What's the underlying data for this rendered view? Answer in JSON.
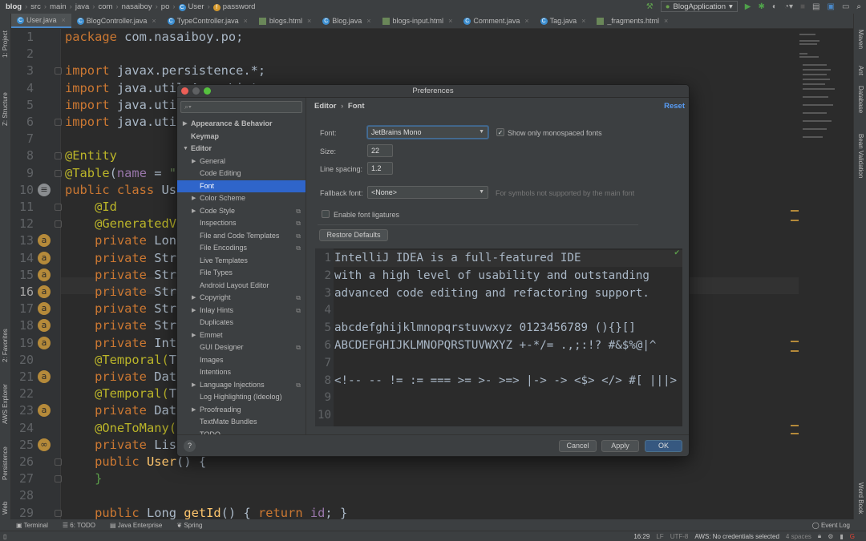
{
  "breadcrumb": [
    "blog",
    "src",
    "main",
    "java",
    "com",
    "nasaiboy",
    "po",
    "User",
    "password"
  ],
  "toolbar": {
    "run_config": "BlogApplication"
  },
  "tabs": [
    {
      "label": "User.java",
      "type": "java",
      "active": true
    },
    {
      "label": "BlogController.java",
      "type": "java"
    },
    {
      "label": "TypeController.java",
      "type": "java"
    },
    {
      "label": "blogs.html",
      "type": "html"
    },
    {
      "label": "Blog.java",
      "type": "java"
    },
    {
      "label": "blogs-input.html",
      "type": "html"
    },
    {
      "label": "Comment.java",
      "type": "java"
    },
    {
      "label": "Tag.java",
      "type": "java"
    },
    {
      "label": "_fragments.html",
      "type": "html"
    }
  ],
  "left_stripe": [
    "1: Project",
    "Z: Structure",
    "2: Favorites",
    "AWS Explorer",
    "Persistence",
    "Web"
  ],
  "right_stripe": [
    "Maven",
    "Ant",
    "Database",
    "Bean Validation",
    "Word Book"
  ],
  "editor": {
    "current_line": 16,
    "lines": [
      [
        [
          "k",
          "package "
        ],
        [
          "t",
          "com.nasaiboy.po;"
        ]
      ],
      [],
      [
        [
          "k",
          "import "
        ],
        [
          "t",
          "javax.persistence.*;"
        ]
      ],
      [
        [
          "k",
          "import "
        ],
        [
          "t",
          "java.util.ArrayList;"
        ]
      ],
      [
        [
          "k",
          "import "
        ],
        [
          "t",
          "java.util."
        ]
      ],
      [
        [
          "k",
          "import "
        ],
        [
          "t",
          "java.util."
        ]
      ],
      [],
      [
        [
          "a",
          "@Entity"
        ]
      ],
      [
        [
          "a",
          "@Table"
        ],
        [
          "t",
          "("
        ],
        [
          "f",
          "name"
        ],
        [
          "t",
          " = "
        ],
        [
          "s",
          "\"t_"
        ]
      ],
      [
        [
          "k",
          "public class "
        ],
        [
          "t",
          "User"
        ]
      ],
      [
        [
          "t",
          "    "
        ],
        [
          "a",
          "@Id"
        ]
      ],
      [
        [
          "t",
          "    "
        ],
        [
          "a",
          "@GeneratedVal"
        ]
      ],
      [
        [
          "t",
          "    "
        ],
        [
          "k",
          "private "
        ],
        [
          "t",
          "Long"
        ]
      ],
      [
        [
          "t",
          "    "
        ],
        [
          "k",
          "private "
        ],
        [
          "t",
          "Strin"
        ]
      ],
      [
        [
          "t",
          "    "
        ],
        [
          "k",
          "private "
        ],
        [
          "t",
          "Strin"
        ]
      ],
      [
        [
          "t",
          "    "
        ],
        [
          "k",
          "private "
        ],
        [
          "t",
          "Strin"
        ]
      ],
      [
        [
          "t",
          "    "
        ],
        [
          "k",
          "private "
        ],
        [
          "t",
          "Strin"
        ]
      ],
      [
        [
          "t",
          "    "
        ],
        [
          "k",
          "private "
        ],
        [
          "t",
          "Strin"
        ]
      ],
      [
        [
          "t",
          "    "
        ],
        [
          "k",
          "private "
        ],
        [
          "t",
          "Integ"
        ]
      ],
      [
        [
          "t",
          "    "
        ],
        [
          "a",
          "@Temporal"
        ],
        [
          "a",
          "("
        ],
        [
          "t",
          "Tem"
        ]
      ],
      [
        [
          "t",
          "    "
        ],
        [
          "k",
          "private "
        ],
        [
          "t",
          "Date"
        ]
      ],
      [
        [
          "t",
          "    "
        ],
        [
          "a",
          "@Temporal"
        ],
        [
          "a",
          "("
        ],
        [
          "t",
          "Tem"
        ]
      ],
      [
        [
          "t",
          "    "
        ],
        [
          "k",
          "private "
        ],
        [
          "t",
          "Date"
        ]
      ],
      [
        [
          "t",
          "    "
        ],
        [
          "a",
          "@OneToMany"
        ],
        [
          "a",
          "("
        ],
        [
          "f",
          "ma"
        ]
      ],
      [
        [
          "t",
          "    "
        ],
        [
          "k",
          "private "
        ],
        [
          "t",
          "List<"
        ]
      ],
      [
        [
          "t",
          "    "
        ],
        [
          "k",
          "public "
        ],
        [
          "m",
          "User"
        ],
        [
          "t",
          "() {"
        ]
      ],
      [
        [
          "t",
          "    "
        ],
        [
          "g",
          "}"
        ]
      ],
      [],
      [
        [
          "t",
          "    "
        ],
        [
          "k",
          "public "
        ],
        [
          "t",
          "Long "
        ],
        [
          "m",
          "getId"
        ],
        [
          "t",
          "() { "
        ],
        [
          "k",
          "return "
        ],
        [
          "f",
          "id"
        ],
        [
          "t",
          "; }"
        ]
      ]
    ]
  },
  "dialog": {
    "title": "Preferences",
    "search_placeholder": "",
    "tree": [
      {
        "label": "Appearance & Behavior",
        "level": 0,
        "arrow": "▶"
      },
      {
        "label": "Keymap",
        "level": 0
      },
      {
        "label": "Editor",
        "level": 0,
        "arrow": "▼"
      },
      {
        "label": "General",
        "level": 1,
        "arrow": "▶"
      },
      {
        "label": "Code Editing",
        "level": 1
      },
      {
        "label": "Font",
        "level": 1,
        "selected": true
      },
      {
        "label": "Color Scheme",
        "level": 1,
        "arrow": "▶"
      },
      {
        "label": "Code Style",
        "level": 1,
        "arrow": "▶",
        "copy": true
      },
      {
        "label": "Inspections",
        "level": 1,
        "copy": true
      },
      {
        "label": "File and Code Templates",
        "level": 1,
        "copy": true
      },
      {
        "label": "File Encodings",
        "level": 1,
        "copy": true
      },
      {
        "label": "Live Templates",
        "level": 1
      },
      {
        "label": "File Types",
        "level": 1
      },
      {
        "label": "Android Layout Editor",
        "level": 1
      },
      {
        "label": "Copyright",
        "level": 1,
        "arrow": "▶",
        "copy": true
      },
      {
        "label": "Inlay Hints",
        "level": 1,
        "arrow": "▶",
        "copy": true
      },
      {
        "label": "Duplicates",
        "level": 1
      },
      {
        "label": "Emmet",
        "level": 1,
        "arrow": "▶"
      },
      {
        "label": "GUI Designer",
        "level": 1,
        "copy": true
      },
      {
        "label": "Images",
        "level": 1
      },
      {
        "label": "Intentions",
        "level": 1
      },
      {
        "label": "Language Injections",
        "level": 1,
        "arrow": "▶",
        "copy": true
      },
      {
        "label": "Log Highlighting (Ideolog)",
        "level": 1
      },
      {
        "label": "Proofreading",
        "level": 1,
        "arrow": "▶"
      },
      {
        "label": "TextMate Bundles",
        "level": 1
      },
      {
        "label": "TODO",
        "level": 1
      }
    ],
    "header": {
      "parent": "Editor",
      "sep": "›",
      "current": "Font",
      "reset": "Reset"
    },
    "font": {
      "label": "Font:",
      "value": "JetBrains Mono"
    },
    "mono_only": {
      "label": "Show only monospaced fonts",
      "checked": true
    },
    "size": {
      "label": "Size:",
      "value": "22"
    },
    "line_spacing": {
      "label": "Line spacing:",
      "value": "1.2"
    },
    "fallback": {
      "label": "Fallback font:",
      "value": "<None>",
      "hint": "For symbols not supported by the main font"
    },
    "ligatures": {
      "label": "Enable font ligatures",
      "checked": false
    },
    "restore": "Restore Defaults",
    "preview": [
      "IntelliJ IDEA is a full-featured IDE",
      "with a high level of usability and outstanding",
      "advanced code editing and refactoring support.",
      "",
      "abcdefghijklmnopqrstuvwxyz 0123456789 (){}[]",
      "ABCDEFGHIJKLMNOPQRSTUVWXYZ +-*/= .,;:!? #&$%@|^",
      "",
      "<!-- -- != := === >= >- >=> |-> -> <$> </> #[ |||> |= ~@",
      "",
      ""
    ],
    "buttons": {
      "help": "?",
      "cancel": "Cancel",
      "apply": "Apply",
      "ok": "OK"
    }
  },
  "bottom_tools": [
    "Terminal",
    "6: TODO",
    "Java Enterprise",
    "Spring"
  ],
  "event_log": "Event Log",
  "status": {
    "position": "16:29",
    "line_sep": "LF",
    "encoding": "UTF-8",
    "aws": "AWS: No credentials selected",
    "indent": "4 spaces"
  },
  "colors": {
    "accent": "#2f65ca",
    "keyword": "#cc7832",
    "annotation": "#bbb529",
    "ok_button": "#365880"
  }
}
